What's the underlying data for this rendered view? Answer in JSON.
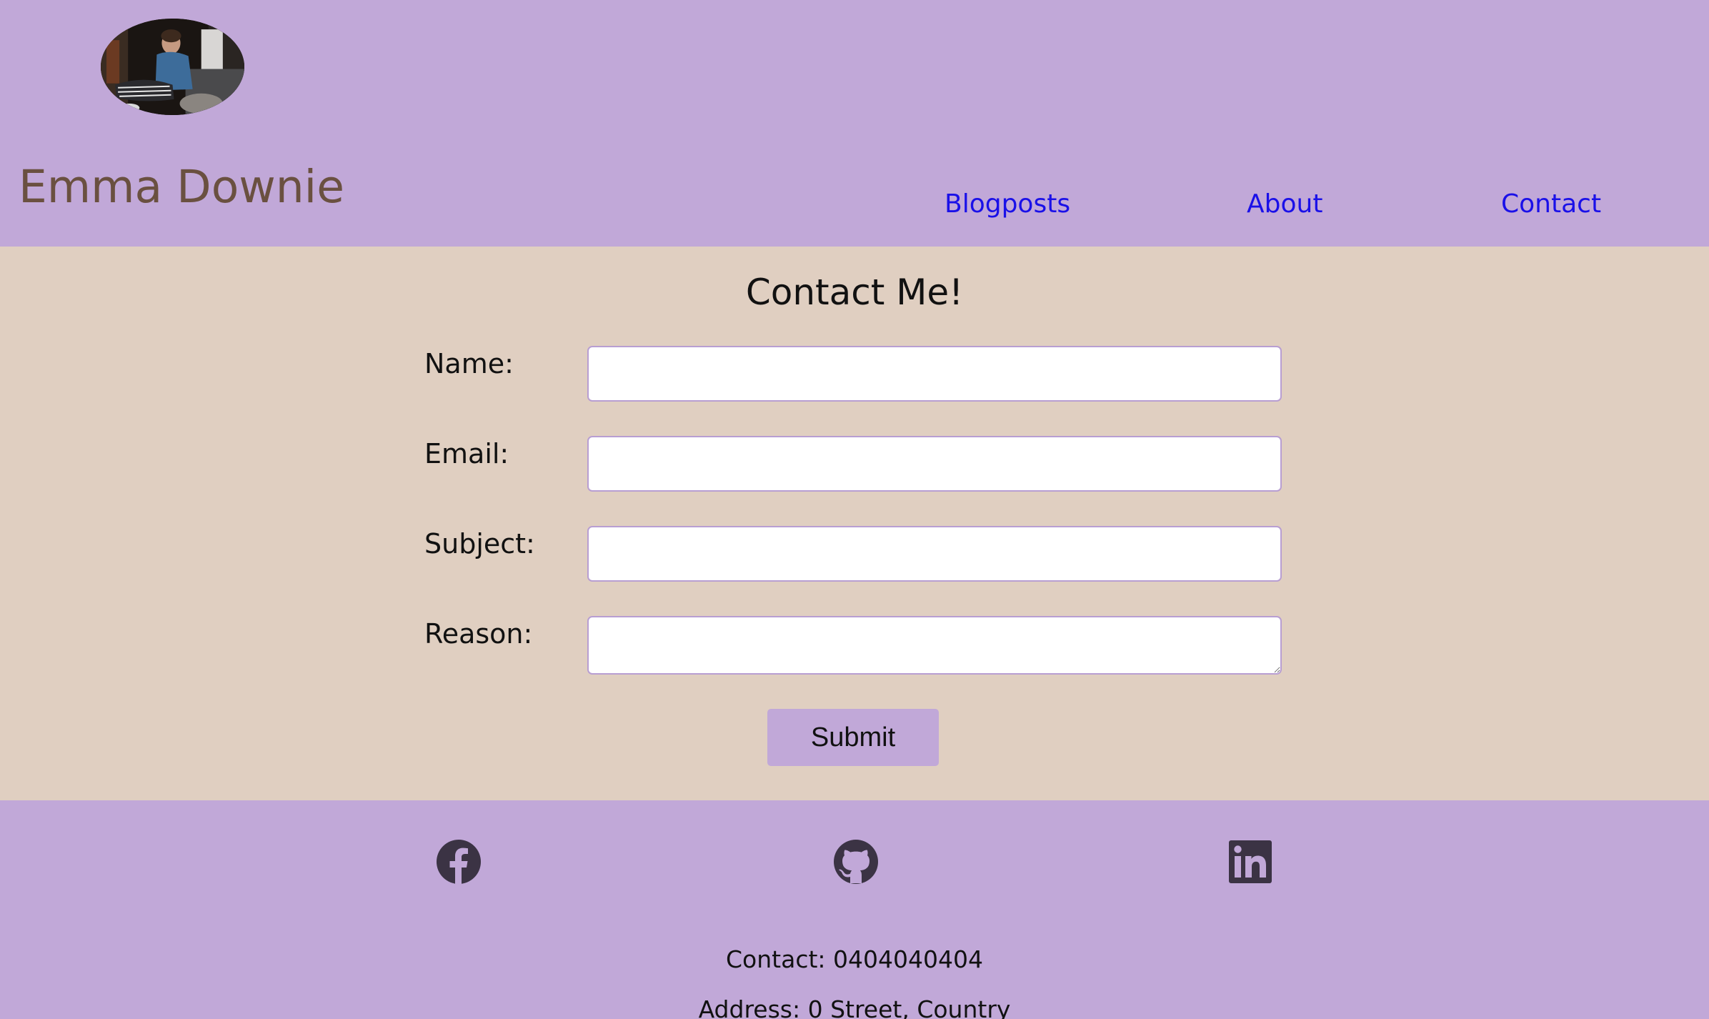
{
  "header": {
    "site_name": "Emma Downie",
    "nav": [
      {
        "label": "Blogposts"
      },
      {
        "label": "About"
      },
      {
        "label": "Contact"
      }
    ]
  },
  "form": {
    "title": "Contact Me!",
    "fields": [
      {
        "label": "Name:",
        "value": "",
        "placeholder": ""
      },
      {
        "label": "Email:",
        "value": "",
        "placeholder": ""
      },
      {
        "label": "Subject:",
        "value": "",
        "placeholder": ""
      },
      {
        "label": "Reason:",
        "value": "",
        "placeholder": ""
      }
    ],
    "submit_label": "Submit"
  },
  "footer": {
    "social": [
      "facebook-icon",
      "github-icon",
      "linkedin-icon"
    ],
    "contact": "Contact: 0404040404",
    "address": "Address: 0 Street, Country"
  },
  "colors": {
    "header_bg": "#c1a8d8",
    "main_bg": "#e0cfc1",
    "site_name": "#6a5040",
    "nav_link": "#1a10e8",
    "icon": "#3b3344"
  }
}
